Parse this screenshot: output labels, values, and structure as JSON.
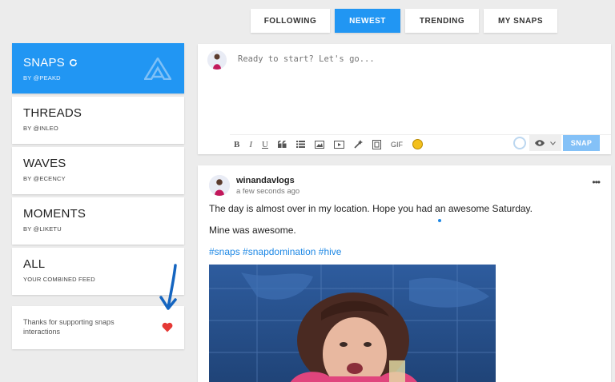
{
  "tabs": [
    {
      "label": "FOLLOWING",
      "active": false
    },
    {
      "label": "NEWEST",
      "active": true
    },
    {
      "label": "TRENDING",
      "active": false
    },
    {
      "label": "MY SNAPS",
      "active": false
    }
  ],
  "sidebar": {
    "items": [
      {
        "title": "SNAPS",
        "sub": "BY @PEAKD",
        "active": true
      },
      {
        "title": "THREADS",
        "sub": "BY @INLEO"
      },
      {
        "title": "WAVES",
        "sub": "BY @ECENCY"
      },
      {
        "title": "MOMENTS",
        "sub": "BY @LIKETU"
      },
      {
        "title": "ALL",
        "sub": "YOUR COMBINED FEED"
      }
    ],
    "thanks": "Thanks for supporting snaps interactions"
  },
  "composer": {
    "placeholder": "Ready to start? Let's go...",
    "toolbar": {
      "bold": "B",
      "italic": "I",
      "underline": "U",
      "gif": "GIF"
    },
    "snap_label": "SNAP"
  },
  "post": {
    "author": "winandavlogs",
    "time": "a few seconds ago",
    "line1": "The day is almost over in my location. Hope you had an awesome Saturday.",
    "line2": "Mine was awesome.",
    "tags": [
      "#snaps",
      "#snapdomination",
      "#hive"
    ]
  },
  "colors": {
    "accent": "#2196f3",
    "heart": "#e53935",
    "link": "#1e88e5",
    "annotation": "#1565c0"
  }
}
